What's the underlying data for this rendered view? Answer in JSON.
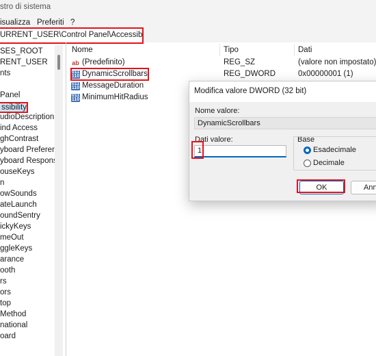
{
  "window": {
    "title": "stro di sistema"
  },
  "menu": [
    "isualizza",
    "Preferiti",
    "?"
  ],
  "address": "URRENT_USER\\Control Panel\\Accessibility",
  "tree": {
    "items": [
      {
        "label": "SES_ROOT",
        "selected": false
      },
      {
        "label": "RENT_USER",
        "selected": false
      },
      {
        "label": "nts",
        "selected": false
      },
      {
        "label": "",
        "selected": false
      },
      {
        "label": "Panel",
        "selected": false
      },
      {
        "label": "ssibility",
        "selected": true
      },
      {
        "label": "udioDescription",
        "selected": false
      },
      {
        "label": "ind Access",
        "selected": false
      },
      {
        "label": "ghContrast",
        "selected": false
      },
      {
        "label": "yboard Preferen",
        "selected": false
      },
      {
        "label": "yboard Respons",
        "selected": false
      },
      {
        "label": "ouseKeys",
        "selected": false
      },
      {
        "label": "n",
        "selected": false
      },
      {
        "label": "owSounds",
        "selected": false
      },
      {
        "label": "ateLaunch",
        "selected": false
      },
      {
        "label": "oundSentry",
        "selected": false
      },
      {
        "label": "ickyKeys",
        "selected": false
      },
      {
        "label": "meOut",
        "selected": false
      },
      {
        "label": "ggleKeys",
        "selected": false
      },
      {
        "label": "arance",
        "selected": false
      },
      {
        "label": "ooth",
        "selected": false
      },
      {
        "label": "rs",
        "selected": false
      },
      {
        "label": "ors",
        "selected": false
      },
      {
        "label": "top",
        "selected": false
      },
      {
        "label": "Method",
        "selected": false
      },
      {
        "label": "national",
        "selected": false
      },
      {
        "label": "oard",
        "selected": false
      }
    ]
  },
  "list": {
    "headers": {
      "name": "Nome",
      "type": "Tipo",
      "data": "Dati"
    },
    "rows": [
      {
        "icon": "string-value-icon",
        "name": "(Predefinito)",
        "type": "REG_SZ",
        "data": "(valore non impostato)"
      },
      {
        "icon": "binary-value-icon",
        "name": "DynamicScrollbars",
        "type": "REG_DWORD",
        "data": "0x00000001 (1)"
      },
      {
        "icon": "binary-value-icon",
        "name": "MessageDuration",
        "type": "",
        "data": ""
      },
      {
        "icon": "binary-value-icon",
        "name": "MinimumHitRadius",
        "type": "",
        "data": ""
      }
    ]
  },
  "dialog": {
    "title": "Modifica valore DWORD (32 bit)",
    "value_name_label": "Nome valore:",
    "value_name": "DynamicScrollbars",
    "value_data_label": "Dati valore:",
    "value_data": "1",
    "base_label": "Base",
    "radio_hex": "Esadecimale",
    "radio_dec": "Decimale",
    "selected_base": "Esadecimale",
    "ok": "OK",
    "cancel": "Ann"
  },
  "colors": {
    "highlight": "#e3121b",
    "accent": "#0067c0",
    "selection": "#cce4f7"
  }
}
